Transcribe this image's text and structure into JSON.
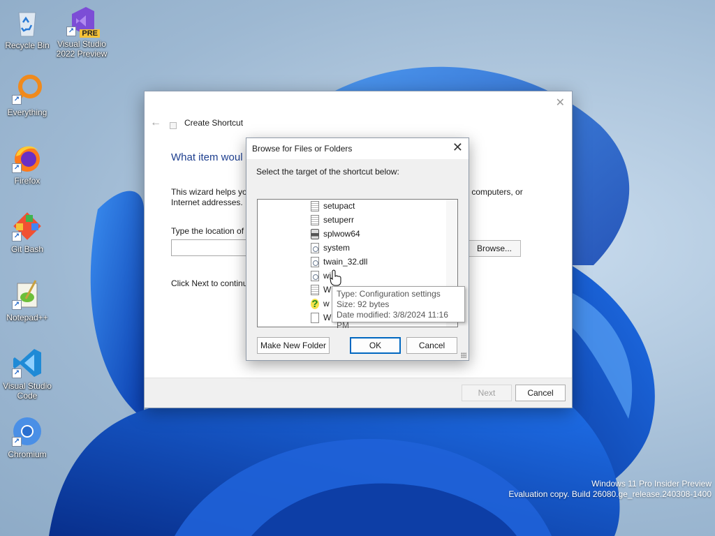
{
  "desktop": {
    "icons": [
      {
        "label": "Recycle Bin",
        "icon": "recycle-bin-icon"
      },
      {
        "label": "Visual Studio 2022 Preview",
        "icon": "visual-studio-icon",
        "badge": "PRE"
      },
      {
        "label": "Everything",
        "icon": "everything-search-icon"
      },
      {
        "label": "Firefox",
        "icon": "firefox-icon"
      },
      {
        "label": "Git Bash",
        "icon": "git-bash-icon"
      },
      {
        "label": "Notepad++",
        "icon": "notepad-plus-plus-icon"
      },
      {
        "label": "Visual Studio Code",
        "icon": "vscode-icon"
      },
      {
        "label": "Chromium",
        "icon": "chromium-icon"
      }
    ],
    "watermark": {
      "line1": "Windows 11 Pro Insider Preview",
      "line2": "Evaluation copy. Build 26080.ge_release.240308-1400"
    }
  },
  "wizard": {
    "title": "Create Shortcut",
    "heading": "What item woul",
    "description_part1": "This wizard helps you",
    "description_part1b": "Internet addresses.",
    "description_part2": "ers, computers, or",
    "location_label": "Type the location of",
    "location_value": "",
    "browse_label": "Browse...",
    "click_next": "Click Next to continu",
    "next_label": "Next",
    "cancel_label": "Cancel"
  },
  "browse_dialog": {
    "title": "Browse for Files or Folders",
    "prompt": "Select the target of the shortcut below:",
    "items": [
      {
        "name": "setupact",
        "icon": "text-file-icon"
      },
      {
        "name": "setuperr",
        "icon": "text-file-icon"
      },
      {
        "name": "splwow64",
        "icon": "printer-app-icon"
      },
      {
        "name": "system",
        "icon": "settings-file-icon"
      },
      {
        "name": "twain_32.dll",
        "icon": "dll-file-icon"
      },
      {
        "name": "wi",
        "icon": "settings-file-icon"
      },
      {
        "name": "W",
        "icon": "text-file-icon"
      },
      {
        "name": "w",
        "icon": "help-file-icon"
      },
      {
        "name": "W",
        "icon": "blank-file-icon"
      }
    ],
    "make_new_folder_label": "Make New Folder",
    "ok_label": "OK",
    "cancel_label": "Cancel"
  },
  "tooltip": {
    "type": "Type: Configuration settings",
    "size": "Size: 92 bytes",
    "date": "Date modified: 3/8/2024 11:16 PM"
  }
}
